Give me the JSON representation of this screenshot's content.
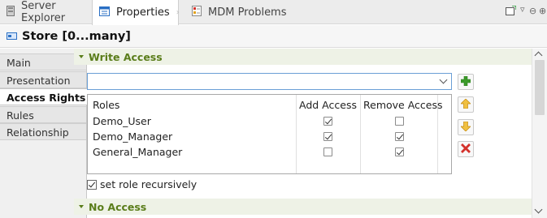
{
  "tabs": [
    {
      "label": "Server Explorer",
      "icon": "server-icon"
    },
    {
      "label": "Properties",
      "icon": "properties-icon",
      "active": true
    },
    {
      "label": "MDM Problems",
      "icon": "problems-icon"
    }
  ],
  "window_controls": [
    "new-view-icon",
    "view-menu-icon",
    "minimize-icon",
    "maximize-icon"
  ],
  "panel": {
    "title": "Store [0...many]"
  },
  "nav": {
    "items": [
      {
        "label": "Main"
      },
      {
        "label": "Presentation"
      },
      {
        "label": "Access Rights",
        "active": true
      },
      {
        "label": "Rules"
      },
      {
        "label": "Relationship"
      }
    ]
  },
  "write_access": {
    "header": "Write Access",
    "combo_value": "",
    "columns": [
      "Roles",
      "Add Access",
      "Remove Access"
    ],
    "rows": [
      {
        "role": "Demo_User",
        "add": true,
        "remove": false
      },
      {
        "role": "Demo_Manager",
        "add": true,
        "remove": true
      },
      {
        "role": "General_Manager",
        "add": false,
        "remove": true
      }
    ],
    "recursive_label": "set role recursively",
    "recursive_checked": true
  },
  "no_access": {
    "header": "No Access"
  },
  "colors": {
    "section_header": "#5a7d1a",
    "add_icon": "#3c9a2a",
    "delete_icon": "#d3312b",
    "arrow_icon": "#e3a21a"
  }
}
